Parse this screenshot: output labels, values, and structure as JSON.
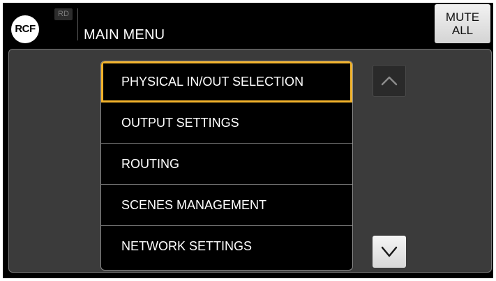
{
  "header": {
    "logo_text": "RCF",
    "badge_text": "RD",
    "title": "MAIN MENU",
    "mute_all": {
      "line1": "MUTE",
      "line2": "ALL"
    }
  },
  "menu": {
    "items": [
      {
        "label": "PHYSICAL IN/OUT SELECTION",
        "selected": true
      },
      {
        "label": "OUTPUT SETTINGS",
        "selected": false
      },
      {
        "label": "ROUTING",
        "selected": false
      },
      {
        "label": "SCENES MANAGEMENT",
        "selected": false
      },
      {
        "label": "NETWORK SETTINGS",
        "selected": false
      }
    ]
  },
  "scroll": {
    "up_icon": "chevron-up-icon",
    "down_icon": "chevron-down-icon",
    "up_enabled": false,
    "down_enabled": true
  },
  "colors": {
    "selection_accent": "#f2b32c",
    "panel_background": "#3b3b3b",
    "screen_background": "#000000"
  }
}
